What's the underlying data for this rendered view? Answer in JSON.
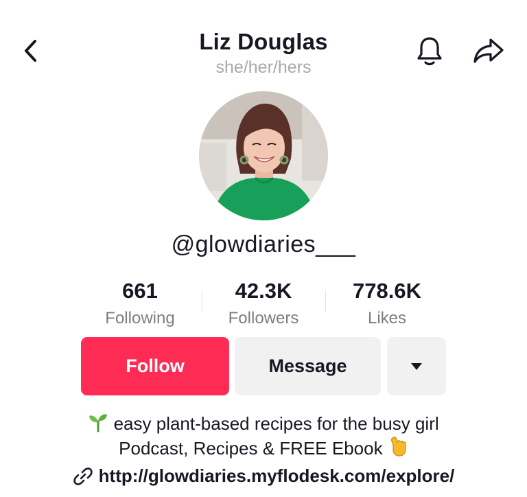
{
  "header": {
    "name": "Liz Douglas",
    "pronouns": "she/her/hers",
    "icons": {
      "back": "chevron-left-icon",
      "notifications": "bell-icon",
      "share": "share-arrow-icon"
    }
  },
  "profile": {
    "handle": "@glowdiaries___",
    "avatar": "profile-photo"
  },
  "stats": [
    {
      "value": "661",
      "label": "Following"
    },
    {
      "value": "42.3K",
      "label": "Followers"
    },
    {
      "value": "778.6K",
      "label": "Likes"
    }
  ],
  "actions": {
    "follow_label": "Follow",
    "message_label": "Message",
    "more_icon": "caret-down-icon"
  },
  "bio": {
    "line1": "easy plant-based recipes for the busy girl",
    "line2": "Podcast, Recipes & FREE Ebook",
    "line1_emoji": "seedling-icon",
    "line2_emoji": "pointing-down-icon"
  },
  "link": {
    "icon": "link-icon",
    "text": "http://glowdiaries.myflodesk.com/explore/"
  },
  "colors": {
    "follow_bg": "#fe2c55",
    "secondary_bg": "#f1f1f2",
    "muted_text": "#7d7e84",
    "pronoun_text": "#a7a8ad",
    "primary_text": "#161823"
  }
}
